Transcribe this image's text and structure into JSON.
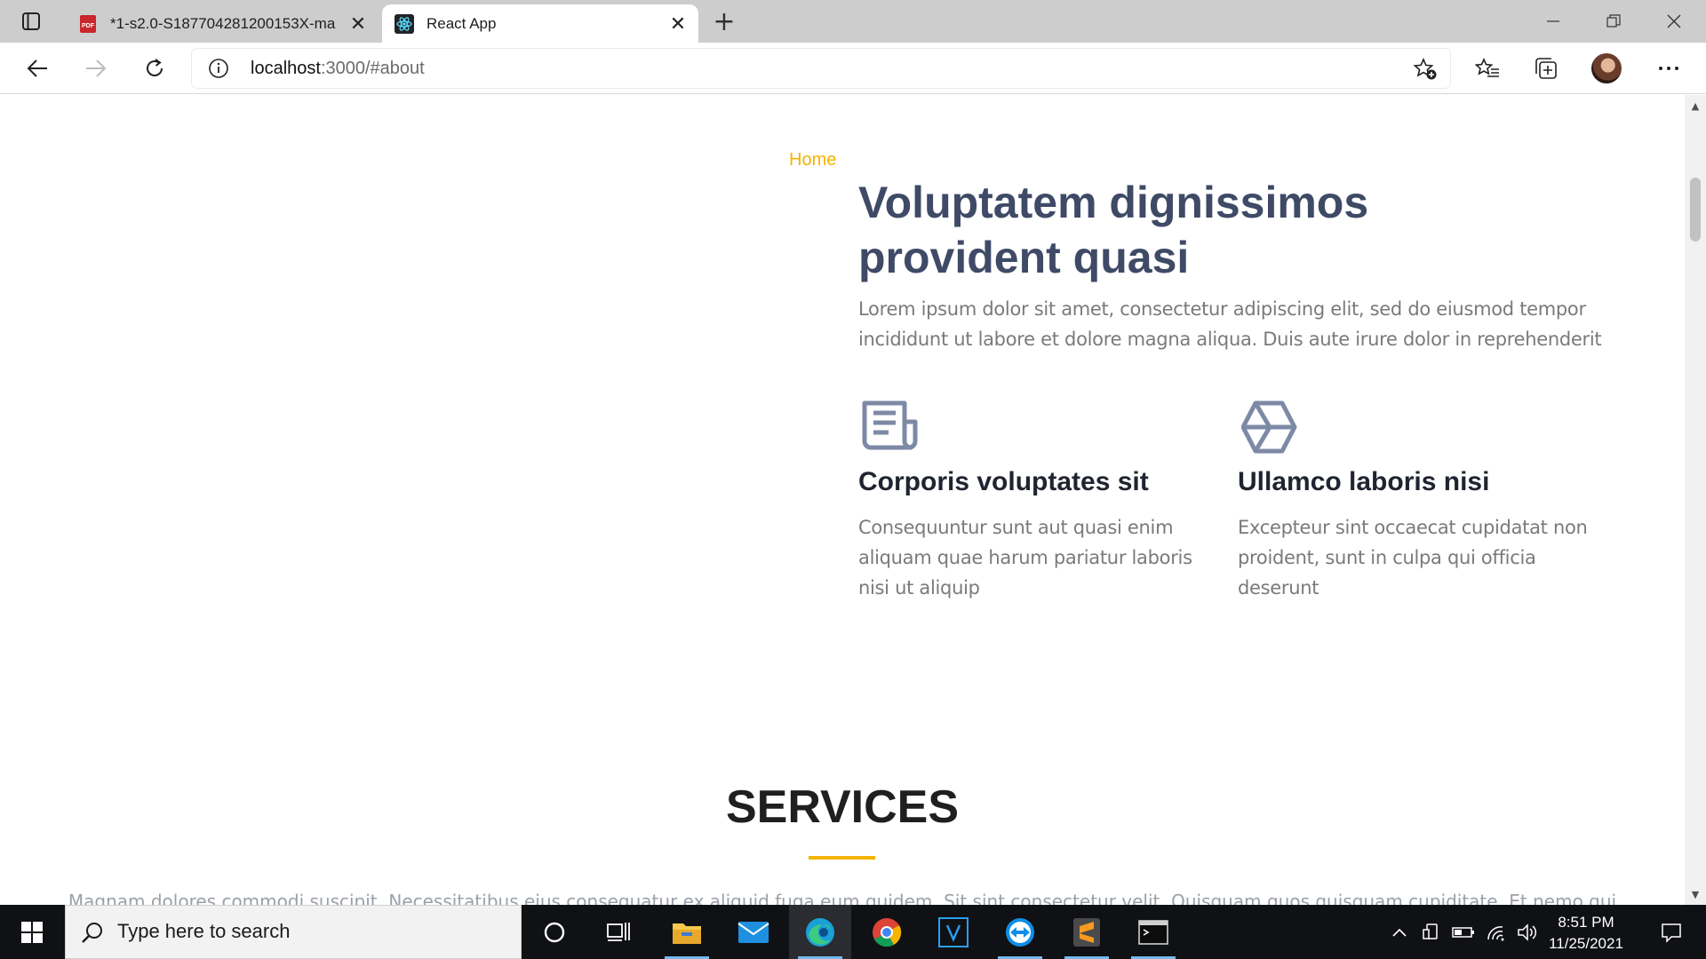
{
  "browser": {
    "tabs": [
      {
        "title": "*1-s2.0-S187704281200153X-ma",
        "icon": "pdf-icon",
        "active": false
      },
      {
        "title": "React App",
        "icon": "react-icon",
        "active": true
      }
    ],
    "new_tab_label": "+",
    "pdf_badge": "PDF",
    "address": {
      "host": "localhost",
      "rest": ":3000/#about"
    }
  },
  "page": {
    "breadcrumb": "Home",
    "hero": {
      "title": "Voluptatem dignissimos provident quasi",
      "text": "Lorem ipsum dolor sit amet, consectetur adipiscing elit, sed do eiusmod tempor incididunt ut labore et dolore magna aliqua. Duis aute irure dolor in reprehenderit"
    },
    "features": [
      {
        "icon": "newspaper-icon",
        "title": "Corporis voluptates sit",
        "text": "Consequuntur sunt aut quasi enim aliquam quae harum pariatur laboris nisi ut aliquip"
      },
      {
        "icon": "hexagon-icon",
        "title": "Ullamco laboris nisi",
        "text": "Excepteur sint occaecat cupidatat non proident, sunt in culpa qui officia deserunt"
      }
    ],
    "services": {
      "title": "SERVICES",
      "text": "Magnam dolores commodi suscipit. Necessitatibus eius consequatur ex aliquid fuga eum quidem. Sit sint consectetur velit. Quisquam quos quisquam cupiditate. Et nemo qui"
    }
  },
  "taskbar": {
    "search_placeholder": "Type here to search",
    "time": "8:51 PM",
    "date": "11/25/2021",
    "apps": [
      "cortana-icon",
      "task-view-icon",
      "file-explorer-icon",
      "mail-icon",
      "edge-icon",
      "chrome-icon",
      "vs-code-icon",
      "teamviewer-icon",
      "sublime-text-icon",
      "terminal-icon"
    ]
  },
  "colors": {
    "accent": "#f5b400",
    "heading": "#3e4a66",
    "body_text": "#7a7a7a",
    "icon": "#7d8aa6"
  }
}
